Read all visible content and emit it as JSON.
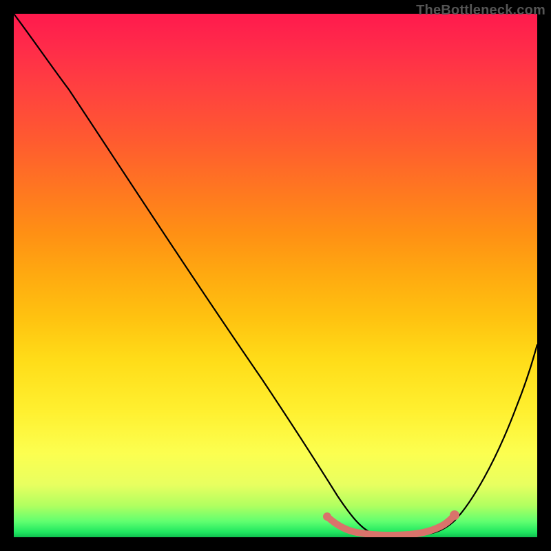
{
  "watermark": "TheBottleneck.com",
  "chart_data": {
    "type": "line",
    "title": "",
    "xlabel": "",
    "ylabel": "",
    "xlim": [
      0,
      100
    ],
    "ylim": [
      0,
      100
    ],
    "grid": false,
    "legend": false,
    "background_gradient": {
      "stops": [
        {
          "pos": 0,
          "color": "#ff1a4d"
        },
        {
          "pos": 14,
          "color": "#ff4040"
        },
        {
          "pos": 34,
          "color": "#ff7820"
        },
        {
          "pos": 50,
          "color": "#ffaa10"
        },
        {
          "pos": 66,
          "color": "#ffdc18"
        },
        {
          "pos": 84,
          "color": "#fcff50"
        },
        {
          "pos": 94,
          "color": "#b0ff60"
        },
        {
          "pos": 100,
          "color": "#10c050"
        }
      ]
    },
    "series": [
      {
        "name": "bottleneck-curve",
        "color": "#000000",
        "x": [
          0,
          3,
          8,
          15,
          25,
          35,
          45,
          55,
          60,
          63,
          66,
          70,
          74,
          78,
          82,
          86,
          90,
          95,
          100
        ],
        "values": [
          100,
          97,
          92,
          84,
          71,
          57,
          43,
          28,
          18,
          10,
          5,
          2,
          1,
          1,
          2,
          5,
          12,
          24,
          40
        ]
      },
      {
        "name": "highlight-flat-region",
        "color": "#d9736b",
        "x": [
          60,
          63,
          66,
          70,
          74,
          78,
          82
        ],
        "values": [
          3,
          2,
          1,
          1,
          1,
          1,
          3
        ]
      }
    ]
  }
}
